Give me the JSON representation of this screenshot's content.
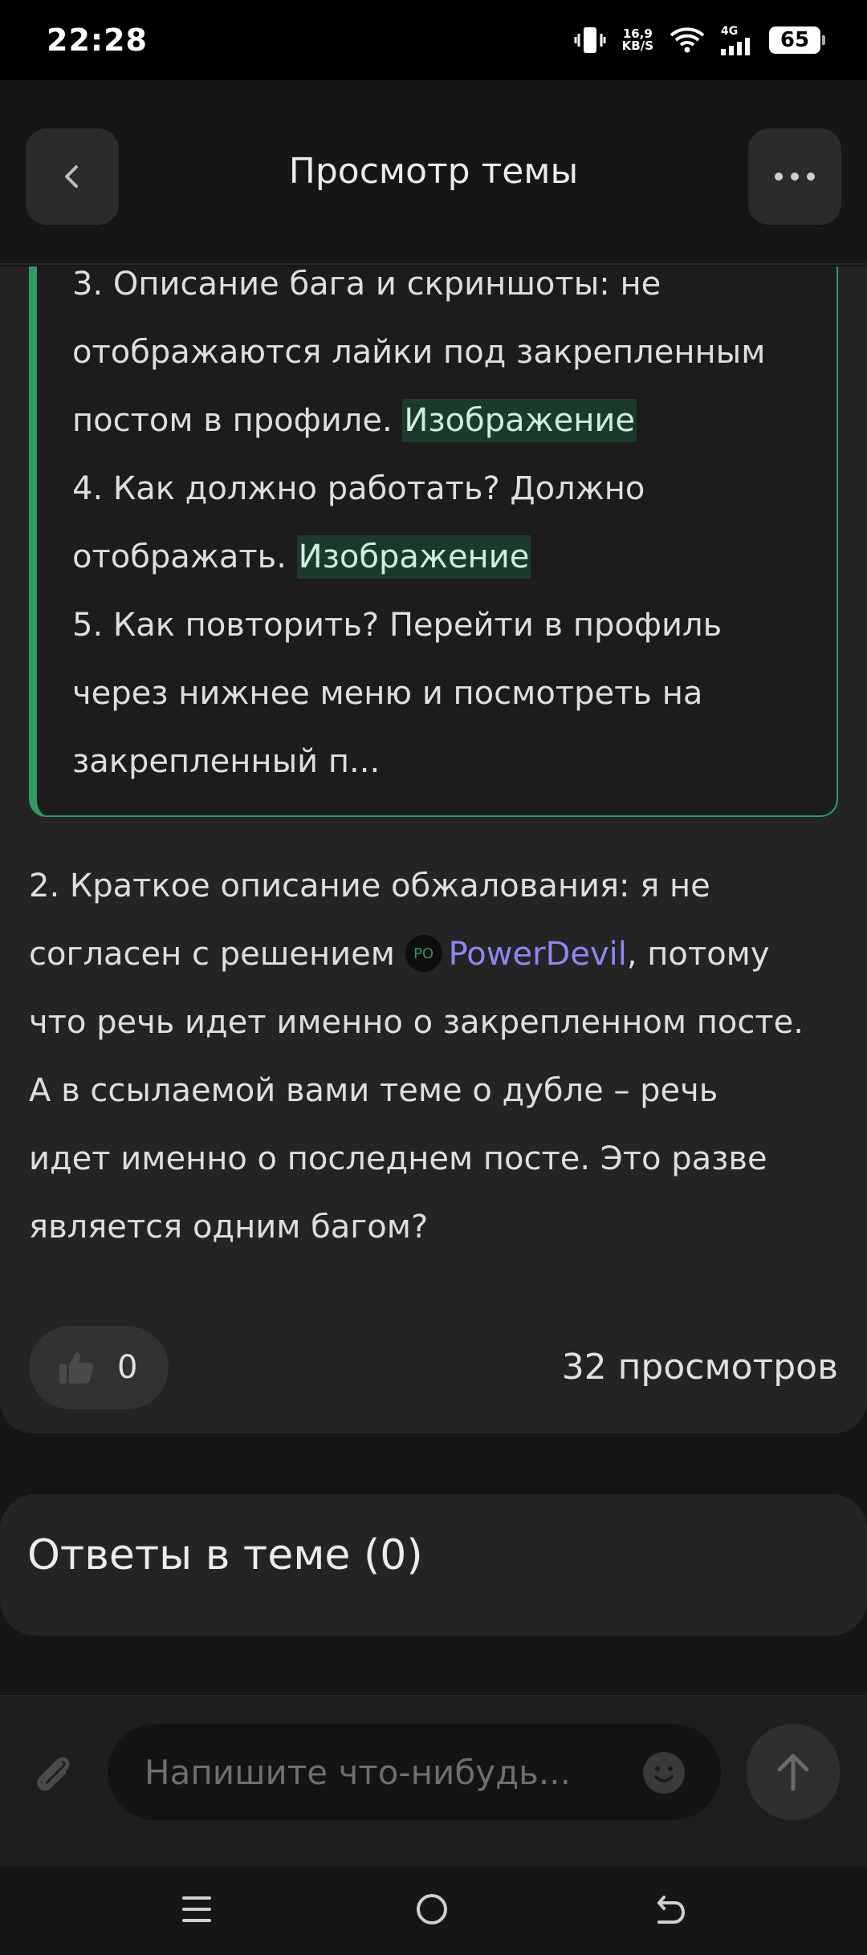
{
  "status_bar": {
    "time": "22:28",
    "net_speed_value": "16,9",
    "net_speed_unit": "KB/S",
    "network_type": "4G",
    "battery": "65"
  },
  "header": {
    "title": "Просмотр темы",
    "back_icon": "chevron-left-icon",
    "more_icon": "more-horizontal-icon"
  },
  "quote": {
    "line1": "3. Описание бага и скриншоты: не",
    "line2": "отображаются лайки под закрепленным",
    "line3_text": "постом в профиле. ",
    "line3_link": "Изображение",
    "line4": "4. Как должно работать? Должно",
    "line5_text": "отображать. ",
    "line5_link": "Изображение",
    "line6": "5. Как повторить? Перейти в профиль",
    "line7": "через нижнее меню и посмотреть на",
    "line8": "закрепленный п..."
  },
  "post_body": {
    "line1": "2. Краткое описание обжалования: я не",
    "line2_pre": "согласен с решением ",
    "mention_avatar": "PO",
    "mention_name": "PowerDevil",
    "line2_post": ", потому",
    "line3": "что речь идет именно о закрепленном посте.",
    "line4": "А в ссылаемой вами теме о дубле – речь",
    "line5": "идет именно о последнем посте. Это разве",
    "line6": "является одним багом?"
  },
  "reactions": {
    "like_count": "0",
    "views": "32 просмотров"
  },
  "answers": {
    "title": "Ответы в теме (0)"
  },
  "composer": {
    "placeholder": "Напишите что-нибудь...",
    "value": ""
  },
  "colors": {
    "accent_green": "#2e9a62",
    "mention_purple": "#8f86f0",
    "background": "#161616",
    "card": "#242424"
  }
}
